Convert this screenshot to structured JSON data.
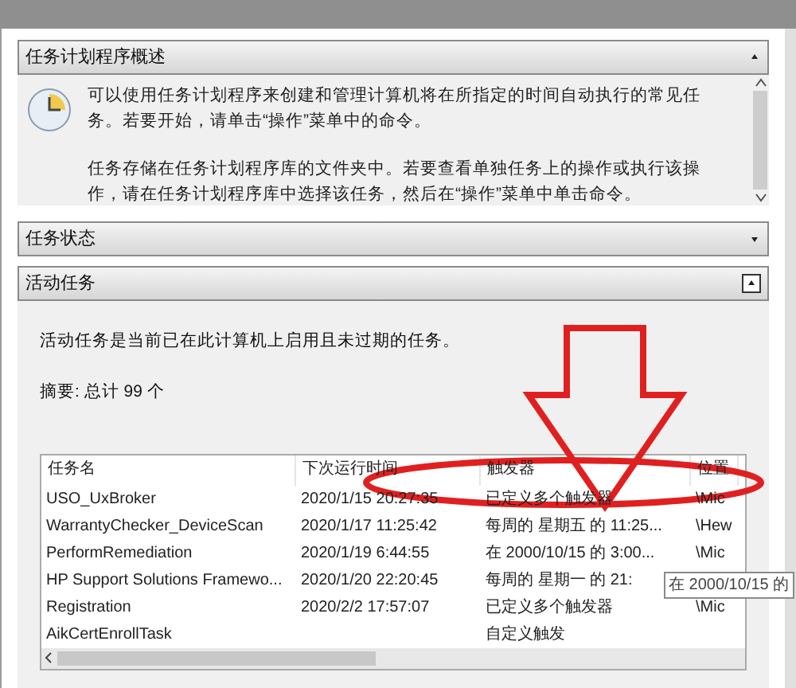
{
  "overview": {
    "title": "任务计划程序概述",
    "expanded": true,
    "paragraphs": [
      "可以使用任务计划程序来创建和管理计算机将在所指定的时间自动执行的常见任务。若要开始，请单击“操作”菜单中的命令。",
      "任务存储在任务计划程序库的文件夹中。若要查看单独任务上的操作或执行该操作，请在任务计划程序库中选择该任务，然后在“操作”菜单中单击命令。"
    ]
  },
  "task_status": {
    "title": "任务状态",
    "expanded": false
  },
  "active_tasks": {
    "title": "活动任务",
    "expanded": true,
    "description": "活动任务是当前已在此计算机上启用且未过期的任务。",
    "summary": "摘要: 总计 99 个",
    "table": {
      "columns": [
        "任务名",
        "下次运行时间",
        "触发器",
        "位置"
      ],
      "rows": [
        {
          "name": "USO_UxBroker",
          "next_run": "2020/1/15 20:27:35",
          "trigger": "已定义多个触发器",
          "location": "\\Mic"
        },
        {
          "name": "WarrantyChecker_DeviceScan",
          "next_run": "2020/1/17 11:25:42",
          "trigger": "每周的 星期五 的 11:25...",
          "location": "\\Hew"
        },
        {
          "name": "PerformRemediation",
          "next_run": "2020/1/19 6:44:55",
          "trigger": "在 2000/10/15 的 3:00...",
          "location": "\\Mic"
        },
        {
          "name": "HP Support Solutions Framewo...",
          "next_run": "2020/1/20 22:20:45",
          "trigger": "每周的 星期一 的 21:"
        },
        {
          "name": "Registration",
          "next_run": "2020/2/2 17:57:07",
          "trigger": "已定义多个触发器",
          "location": "\\Mic"
        },
        {
          "name": "AikCertEnrollTask",
          "trigger": "自定义触发"
        }
      ]
    },
    "tooltip": "在 2000/10/15 的"
  }
}
